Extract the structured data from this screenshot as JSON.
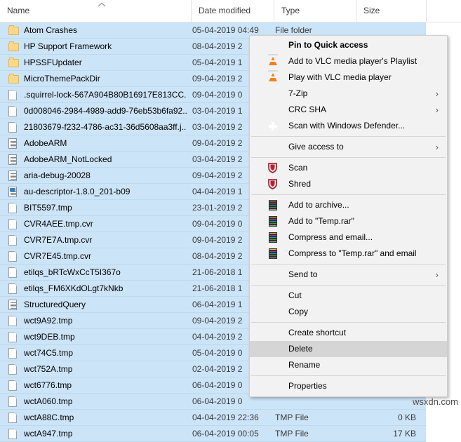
{
  "file_list": {
    "columns": [
      {
        "label": "Name",
        "sort_indicator": "chevron-up-icon"
      },
      {
        "label": "Date modified"
      },
      {
        "label": "Type"
      },
      {
        "label": "Size"
      }
    ],
    "rows": [
      {
        "icon": "folder-icon",
        "name": "Atom Crashes",
        "date": "05-04-2019 04:49",
        "type": "File folder",
        "size": ""
      },
      {
        "icon": "folder-icon",
        "name": "HP Support Framework",
        "date": "08-04-2019 2",
        "type": "",
        "size": ""
      },
      {
        "icon": "folder-icon",
        "name": "HPSSFUpdater",
        "date": "05-04-2019 1",
        "type": "",
        "size": ""
      },
      {
        "icon": "folder-icon",
        "name": "MicroThemePackDir",
        "date": "09-04-2019 2",
        "type": "",
        "size": ""
      },
      {
        "icon": "file-icon",
        "name": ".squirrel-lock-567A904B80B16917E813CC...",
        "date": "09-04-2019 0",
        "type": "",
        "size": ""
      },
      {
        "icon": "file-icon",
        "name": "0d008046-2984-4989-add9-76eb53b6fa92...",
        "date": "03-04-2019 1",
        "type": "",
        "size": ""
      },
      {
        "icon": "file-icon",
        "name": "21803679-f232-4786-ac31-36d5608aa3ff.j...",
        "date": "03-04-2019 2",
        "type": "",
        "size": ""
      },
      {
        "icon": "document-icon",
        "name": "AdobeARM",
        "date": "09-04-2019 2",
        "type": "",
        "size": ""
      },
      {
        "icon": "document-icon",
        "name": "AdobeARM_NotLocked",
        "date": "03-04-2019 2",
        "type": "",
        "size": ""
      },
      {
        "icon": "document-icon",
        "name": "aria-debug-20028",
        "date": "09-04-2019 2",
        "type": "",
        "size": ""
      },
      {
        "icon": "xml-icon",
        "name": "au-descriptor-1.8.0_201-b09",
        "date": "04-04-2019 1",
        "type": "",
        "size": ""
      },
      {
        "icon": "file-icon",
        "name": "BIT5597.tmp",
        "date": "23-01-2019 2",
        "type": "",
        "size": ""
      },
      {
        "icon": "file-icon",
        "name": "CVR4AEE.tmp.cvr",
        "date": "09-04-2019 0",
        "type": "",
        "size": ""
      },
      {
        "icon": "file-icon",
        "name": "CVR7E7A.tmp.cvr",
        "date": "09-04-2019 2",
        "type": "",
        "size": ""
      },
      {
        "icon": "file-icon",
        "name": "CVR7E45.tmp.cvr",
        "date": "08-04-2019 2",
        "type": "",
        "size": ""
      },
      {
        "icon": "file-icon",
        "name": "etilqs_bRTcWxCcT5I367o",
        "date": "21-06-2018 1",
        "type": "",
        "size": ""
      },
      {
        "icon": "file-icon",
        "name": "etilqs_FM6XKdOLgt7kNkb",
        "date": "21-06-2018 1",
        "type": "",
        "size": ""
      },
      {
        "icon": "document-icon",
        "name": "StructuredQuery",
        "date": "06-04-2019 1",
        "type": "",
        "size": ""
      },
      {
        "icon": "file-icon",
        "name": "wct9A92.tmp",
        "date": "09-04-2019 2",
        "type": "",
        "size": ""
      },
      {
        "icon": "file-icon",
        "name": "wct9DEB.tmp",
        "date": "04-04-2019 2",
        "type": "",
        "size": ""
      },
      {
        "icon": "file-icon",
        "name": "wct74C5.tmp",
        "date": "05-04-2019 0",
        "type": "",
        "size": ""
      },
      {
        "icon": "file-icon",
        "name": "wct752A.tmp",
        "date": "02-04-2019 2",
        "type": "",
        "size": ""
      },
      {
        "icon": "file-icon",
        "name": "wct6776.tmp",
        "date": "06-04-2019 0",
        "type": "",
        "size": ""
      },
      {
        "icon": "file-icon",
        "name": "wctA060.tmp",
        "date": "06-04-2019 0",
        "type": "",
        "size": ""
      },
      {
        "icon": "file-icon",
        "name": "wctA88C.tmp",
        "date": "04-04-2019 22:36",
        "type": "TMP File",
        "size": "0 KB"
      },
      {
        "icon": "file-icon",
        "name": "wctA947.tmp",
        "date": "06-04-2019 00:05",
        "type": "TMP File",
        "size": "17 KB"
      }
    ]
  },
  "context_menu": {
    "items": [
      {
        "label": "Pin to Quick access",
        "icon": "",
        "bold": true,
        "submenu": false,
        "separator_after": false,
        "selected": false
      },
      {
        "label": "Add to VLC media player's Playlist",
        "icon": "vlc-icon",
        "bold": false,
        "submenu": false,
        "separator_after": false,
        "selected": false
      },
      {
        "label": "Play with VLC media player",
        "icon": "vlc-icon",
        "bold": false,
        "submenu": false,
        "separator_after": false,
        "selected": false
      },
      {
        "label": "7-Zip",
        "icon": "",
        "bold": false,
        "submenu": true,
        "separator_after": false,
        "selected": false
      },
      {
        "label": "CRC SHA",
        "icon": "",
        "bold": false,
        "submenu": true,
        "separator_after": false,
        "selected": false
      },
      {
        "label": "Scan with Windows Defender...",
        "icon": "defender-icon",
        "bold": false,
        "submenu": false,
        "separator_after": true,
        "selected": false
      },
      {
        "label": "Give access to",
        "icon": "",
        "bold": false,
        "submenu": true,
        "separator_after": true,
        "selected": false
      },
      {
        "label": "Scan",
        "icon": "red-shield-icon",
        "bold": false,
        "submenu": false,
        "separator_after": false,
        "selected": false
      },
      {
        "label": "Shred",
        "icon": "red-shield-icon",
        "bold": false,
        "submenu": false,
        "separator_after": true,
        "selected": false
      },
      {
        "label": "Add to archive...",
        "icon": "winrar-icon",
        "bold": false,
        "submenu": false,
        "separator_after": false,
        "selected": false
      },
      {
        "label": "Add to \"Temp.rar\"",
        "icon": "winrar-icon",
        "bold": false,
        "submenu": false,
        "separator_after": false,
        "selected": false
      },
      {
        "label": "Compress and email...",
        "icon": "winrar-icon",
        "bold": false,
        "submenu": false,
        "separator_after": false,
        "selected": false
      },
      {
        "label": "Compress to \"Temp.rar\" and email",
        "icon": "winrar-icon",
        "bold": false,
        "submenu": false,
        "separator_after": true,
        "selected": false
      },
      {
        "label": "Send to",
        "icon": "",
        "bold": false,
        "submenu": true,
        "separator_after": true,
        "selected": false
      },
      {
        "label": "Cut",
        "icon": "",
        "bold": false,
        "submenu": false,
        "separator_after": false,
        "selected": false
      },
      {
        "label": "Copy",
        "icon": "",
        "bold": false,
        "submenu": false,
        "separator_after": true,
        "selected": false
      },
      {
        "label": "Create shortcut",
        "icon": "",
        "bold": false,
        "submenu": false,
        "separator_after": false,
        "selected": false
      },
      {
        "label": "Delete",
        "icon": "",
        "bold": false,
        "submenu": false,
        "separator_after": false,
        "selected": true
      },
      {
        "label": "Rename",
        "icon": "",
        "bold": false,
        "submenu": false,
        "separator_after": true,
        "selected": false
      },
      {
        "label": "Properties",
        "icon": "",
        "bold": false,
        "submenu": false,
        "separator_after": false,
        "selected": false
      }
    ],
    "submenu_arrow": "›"
  },
  "watermark": {
    "text": "wsxdn.com"
  },
  "colors": {
    "selection": "#cce4f7",
    "menu_bg": "#f2f2f2",
    "menu_highlight": "#d5d5d5",
    "header_text": "#3b3b3b"
  }
}
